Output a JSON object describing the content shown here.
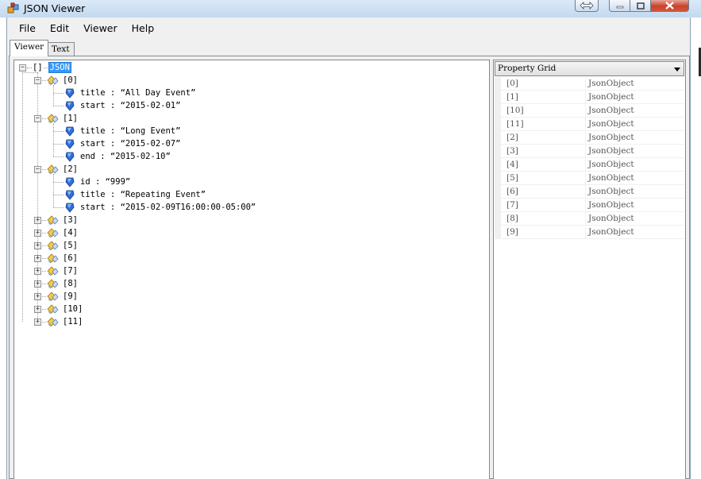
{
  "window": {
    "title": "JSON Viewer",
    "icon": "app-icon"
  },
  "menu": [
    "File",
    "Edit",
    "Viewer",
    "Help"
  ],
  "tabs": [
    "Viewer",
    "Text"
  ],
  "tree": {
    "root_label": "JSON",
    "root_prefix": "[]",
    "nodes": [
      {
        "label": "[0]",
        "children": [
          {
            "text": "title : “All Day Event”"
          },
          {
            "text": "start : “2015-02-01”"
          }
        ]
      },
      {
        "label": "[1]",
        "children": [
          {
            "text": "title : “Long Event”"
          },
          {
            "text": "start : “2015-02-07”"
          },
          {
            "text": "end : “2015-02-10”"
          }
        ]
      },
      {
        "label": "[2]",
        "children": [
          {
            "text": "id : “999”"
          },
          {
            "text": "title : “Repeating Event”"
          },
          {
            "text": "start : “2015-02-09T16:00:00-05:00”"
          }
        ]
      },
      {
        "label": "[3]"
      },
      {
        "label": "[4]"
      },
      {
        "label": "[5]"
      },
      {
        "label": "[6]"
      },
      {
        "label": "[7]"
      },
      {
        "label": "[8]"
      },
      {
        "label": "[9]"
      },
      {
        "label": "[10]"
      },
      {
        "label": "[11]"
      }
    ]
  },
  "property_grid": {
    "combo_label": "Property Grid",
    "rows": [
      {
        "name": "[0]",
        "value": "JsonObject"
      },
      {
        "name": "[1]",
        "value": "JsonObject"
      },
      {
        "name": "[10]",
        "value": "JsonObject"
      },
      {
        "name": "[11]",
        "value": "JsonObject"
      },
      {
        "name": "[2]",
        "value": "JsonObject"
      },
      {
        "name": "[3]",
        "value": "JsonObject"
      },
      {
        "name": "[4]",
        "value": "JsonObject"
      },
      {
        "name": "[5]",
        "value": "JsonObject"
      },
      {
        "name": "[6]",
        "value": "JsonObject"
      },
      {
        "name": "[7]",
        "value": "JsonObject"
      },
      {
        "name": "[8]",
        "value": "JsonObject"
      },
      {
        "name": "[9]",
        "value": "JsonObject"
      }
    ]
  },
  "colors": {
    "selection": "#3399ff",
    "object_icon": "#f0c040",
    "value_icon": "#2f6fd6"
  }
}
